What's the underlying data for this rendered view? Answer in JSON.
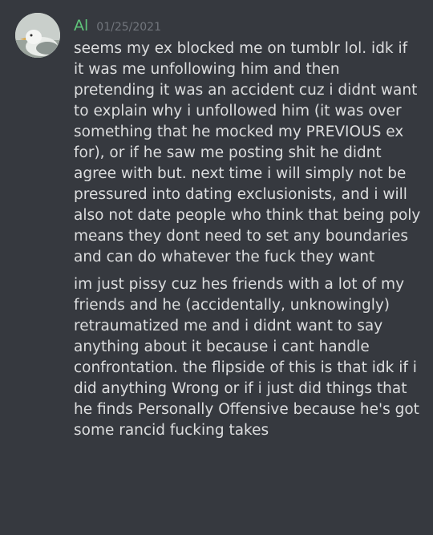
{
  "message": {
    "username": "Al",
    "username_color": "#5fc47a",
    "timestamp": "01/25/2021",
    "avatar_icon": "seagull-avatar-icon",
    "paragraphs": [
      "seems my ex blocked me on tumblr lol. idk if it was me unfollowing him and then pretending it was an accident cuz i didnt want to explain why i unfollowed him (it was over something that he mocked my PREVIOUS ex for), or if he saw me posting shit he didnt agree with but. next time i will simply not be pressured into dating exclusionists, and i will also not date people who think that being poly means they dont need to set any boundaries and can do whatever the fuck they want",
      "im just pissy cuz hes friends with a lot of my friends and he (accidentally, unknowingly) retraumatized me and i didnt want to say anything about it because i cant handle confrontation. the flipside of this is that idk if i did anything Wrong or if i just did things that he finds Personally Offensive because he's got some rancid fucking takes"
    ]
  },
  "colors": {
    "background": "#36393f",
    "text": "#dcddde",
    "timestamp": "#72767d"
  }
}
